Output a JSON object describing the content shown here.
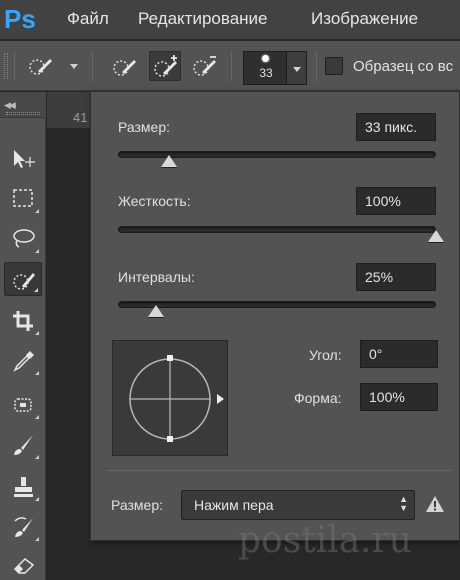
{
  "app": {
    "logo": "Ps",
    "accent": "#31a8ff"
  },
  "menu": {
    "file": "Файл",
    "edit": "Редактирование",
    "image": "Изображение"
  },
  "options_bar": {
    "brush_size": "33",
    "sample_all_layers_label": "Образец со вс",
    "sample_all_layers_checked": false,
    "icons": [
      "quick-selection-icon",
      "new-selection-icon",
      "add-selection-icon",
      "subtract-selection-icon"
    ]
  },
  "toolbar": {
    "collapse": "◀◀",
    "tools": [
      "move-icon",
      "marquee-icon",
      "lasso-icon",
      "quick-selection-icon",
      "crop-icon",
      "eyedropper-icon",
      "healing-brush-icon",
      "brush-icon",
      "clone-stamp-icon",
      "history-brush-icon",
      "eraser-icon"
    ],
    "active_tool": "quick-selection-icon"
  },
  "document": {
    "tab_fragment": "41"
  },
  "brush_panel": {
    "size_label": "Размер:",
    "size_value": "33 пикс.",
    "size_slider": 0.16,
    "hardness_label": "Жесткость:",
    "hardness_value": "100%",
    "hardness_slider": 1.0,
    "spacing_label": "Интервалы:",
    "spacing_value": "25%",
    "spacing_slider": 0.12,
    "angle_label": "Угол:",
    "angle_value": "0°",
    "roundness_label": "Форма:",
    "roundness_value": "100%",
    "pen_size_label": "Размер:",
    "pen_size_option": "Нажим пера"
  },
  "watermark": "postila.ru"
}
